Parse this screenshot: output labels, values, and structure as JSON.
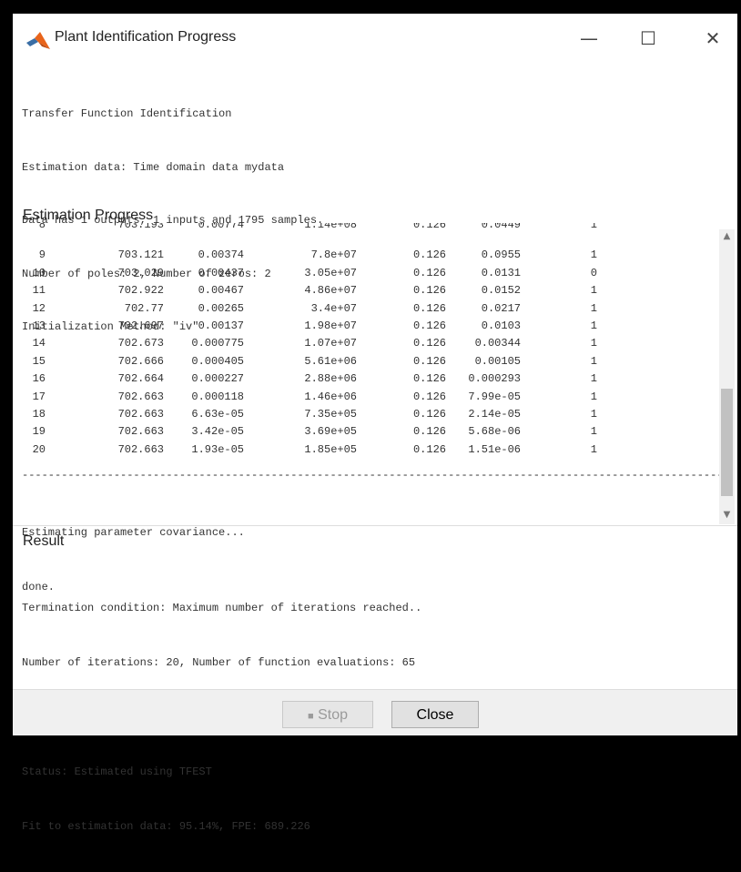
{
  "window": {
    "title": "Plant Identification Progress",
    "minimize": "—",
    "maximize": "☐",
    "close": "✕"
  },
  "info": {
    "lines": [
      "Transfer Function Identification",
      "Estimation data: Time domain data mydata",
      "Data has 1 outputs, 1 inputs and 1795 samples.",
      "Number of poles: 2, Number of zeros: 2",
      "Initialization Method: \"iv\""
    ]
  },
  "estimation_progress": {
    "label": "Estimation Progress",
    "rows": [
      [
        "8",
        "703.193",
        "0.00774",
        "1.14e+08",
        "0.126",
        "0.0449",
        "1"
      ],
      [
        "9",
        "703.121",
        "0.00374",
        "7.8e+07",
        "0.126",
        "0.0955",
        "1"
      ],
      [
        "10",
        "703.029",
        "0.00437",
        "3.05e+07",
        "0.126",
        "0.0131",
        "0"
      ],
      [
        "11",
        "702.922",
        "0.00467",
        "4.86e+07",
        "0.126",
        "0.0152",
        "1"
      ],
      [
        "12",
        "702.77",
        "0.00265",
        "3.4e+07",
        "0.126",
        "0.0217",
        "1"
      ],
      [
        "13",
        "702.697",
        "0.00137",
        "1.98e+07",
        "0.126",
        "0.0103",
        "1"
      ],
      [
        "14",
        "702.673",
        "0.000775",
        "1.07e+07",
        "0.126",
        "0.00344",
        "1"
      ],
      [
        "15",
        "702.666",
        "0.000405",
        "5.61e+06",
        "0.126",
        "0.00105",
        "1"
      ],
      [
        "16",
        "702.664",
        "0.000227",
        "2.88e+06",
        "0.126",
        "0.000293",
        "1"
      ],
      [
        "17",
        "702.663",
        "0.000118",
        "1.46e+06",
        "0.126",
        "7.99e-05",
        "1"
      ],
      [
        "18",
        "702.663",
        "6.63e-05",
        "7.35e+05",
        "0.126",
        "2.14e-05",
        "1"
      ],
      [
        "19",
        "702.663",
        "3.42e-05",
        "3.69e+05",
        "0.126",
        "5.68e-06",
        "1"
      ],
      [
        "20",
        "702.663",
        "1.93e-05",
        "1.85e+05",
        "0.126",
        "1.51e-06",
        "1"
      ]
    ],
    "separator": "----------------------------------------------------------------------------------------------------------------",
    "after_lines": [
      "Estimating parameter covariance...",
      "done."
    ],
    "scroll_up": "▲",
    "scroll_down": "▼"
  },
  "result": {
    "label": "Result",
    "lines": [
      "Termination condition: Maximum number of iterations reached..",
      "Number of iterations: 20, Number of function evaluations: 65",
      "",
      "Status: Estimated using TFEST",
      "Fit to estimation data: 95.14%, FPE: 689.226"
    ]
  },
  "footer": {
    "stop_label": "Stop",
    "stop_icon": "■",
    "close_label": "Close"
  }
}
